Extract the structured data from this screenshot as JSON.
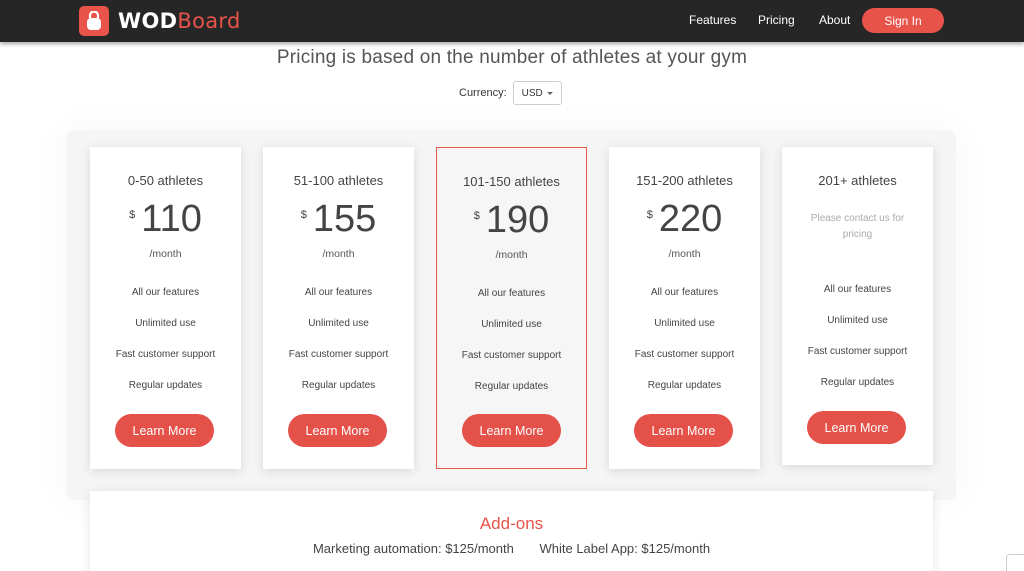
{
  "brand": {
    "wod": "WOD",
    "board": "Board",
    "accent": "#e8534a"
  },
  "nav": {
    "features": "Features",
    "pricing": "Pricing",
    "about": "About",
    "signin": "Sign In"
  },
  "headline": "Pricing is based on the number of athletes at your gym",
  "currency": {
    "label": "Currency:",
    "selected": "USD"
  },
  "plans": [
    {
      "title": "0-50 athletes",
      "symbol": "$",
      "amount": "110",
      "period": "/month",
      "features": [
        "All our features",
        "Unlimited use",
        "Fast customer support",
        "Regular updates"
      ],
      "button": "Learn More"
    },
    {
      "title": "51-100 athletes",
      "symbol": "$",
      "amount": "155",
      "period": "/month",
      "features": [
        "All our features",
        "Unlimited use",
        "Fast customer support",
        "Regular updates"
      ],
      "button": "Learn More"
    },
    {
      "title": "101-150 athletes",
      "symbol": "$",
      "amount": "190",
      "period": "/month",
      "features": [
        "All our features",
        "Unlimited use",
        "Fast customer support",
        "Regular updates"
      ],
      "button": "Learn More"
    },
    {
      "title": "151-200 athletes",
      "symbol": "$",
      "amount": "220",
      "period": "/month",
      "features": [
        "All our features",
        "Unlimited use",
        "Fast customer support",
        "Regular updates"
      ],
      "button": "Learn More"
    },
    {
      "title": "201+ athletes",
      "contact": "Please contact us for pricing",
      "features": [
        "All our features",
        "Unlimited use",
        "Fast customer support",
        "Regular updates"
      ],
      "button": "Learn More"
    }
  ],
  "addons": {
    "title": "Add-ons",
    "items": [
      "Marketing automation: $125/month",
      "White Label App: $125/month"
    ]
  }
}
